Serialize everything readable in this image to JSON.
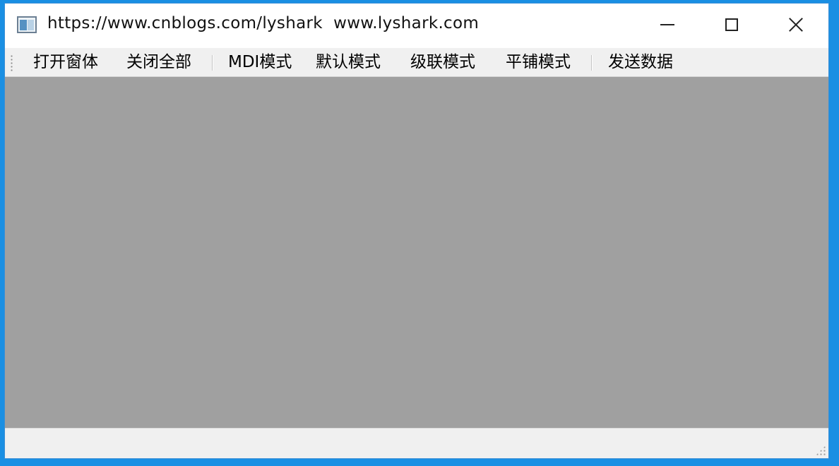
{
  "window": {
    "title": "https://www.cnblogs.com/lyshark  www.lyshark.com"
  },
  "icons": {
    "app": "app-window-icon",
    "minimize": "minimize-icon",
    "maximize": "maximize-icon",
    "close": "close-icon",
    "grip": "toolbar-grip-icon",
    "size_grip": "size-grip-icon"
  },
  "toolbar": {
    "items": [
      {
        "label": "打开窗体"
      },
      {
        "label": "关闭全部"
      },
      {
        "label": "MDI模式"
      },
      {
        "label": "默认模式"
      },
      {
        "label": "级联模式"
      },
      {
        "label": "平铺模式"
      },
      {
        "label": "发送数据"
      }
    ]
  },
  "colors": {
    "desktop": "#1a8fe3",
    "mdi_background": "#a0a0a0",
    "toolbar_background": "#f0f0f0"
  },
  "statusbar": {
    "text": ""
  }
}
